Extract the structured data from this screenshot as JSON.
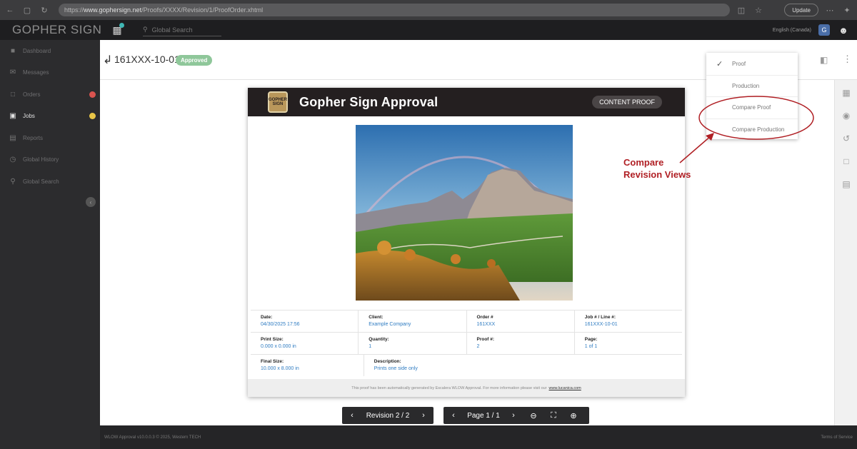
{
  "browser": {
    "url_prefix": "https://",
    "url_host": "www.gophersign.net",
    "url_path": "/Proofs/XXXX/Revision/1/ProofOrder.xhtml",
    "update_label": "Update"
  },
  "app": {
    "logo": "GOPHER SIGN",
    "search_placeholder": "Global Search",
    "language": "English (Canada)",
    "user_initial": "G"
  },
  "sidebar": {
    "items": [
      {
        "label": "Dashboard",
        "icon": "dashboard-icon"
      },
      {
        "label": "Messages",
        "icon": "messages-icon"
      },
      {
        "label": "Orders",
        "icon": "orders-icon",
        "badge_color": "#d9534f"
      },
      {
        "label": "Jobs",
        "icon": "jobs-icon",
        "badge_color": "#e8c547",
        "active": true
      },
      {
        "label": "Reports",
        "icon": "reports-icon"
      },
      {
        "label": "Global History",
        "icon": "history-icon"
      },
      {
        "label": "Global Search",
        "icon": "search-icon"
      }
    ]
  },
  "header": {
    "job_id": "161XXX-10-01",
    "status": "Approved",
    "partial_text": "f"
  },
  "proof": {
    "title": "Gopher Sign Approval",
    "logo_text": "GOPHER SIGN",
    "pill": "CONTENT PROOF",
    "fields": [
      [
        {
          "label": "Date:",
          "value": "04/30/2025 17:56"
        },
        {
          "label": "Client:",
          "value": "Example Company"
        },
        {
          "label": "Order #",
          "value": "161XXX"
        },
        {
          "label": "Job # / Line #:",
          "value": "161XXX-10-01"
        }
      ],
      [
        {
          "label": "Print Size:",
          "value": "0.000 x 0.000 in"
        },
        {
          "label": "Quantity:",
          "value": "1"
        },
        {
          "label": "Proof #:",
          "value": "2"
        },
        {
          "label": "Page:",
          "value": "1 of 1"
        }
      ],
      [
        {
          "label": "Final Size:",
          "value": "10.000 x 8.000 in"
        },
        {
          "label": "Description:",
          "value": "Prints one side only"
        }
      ]
    ],
    "footer_text": "This proof has been automatically generated by Escalera WLOW Approval. For more information please visit our",
    "footer_link": "www.lucanica.com"
  },
  "controls": {
    "revision_label": "Revision 2 / 2",
    "page_label": "Page 1 / 1"
  },
  "status_bar": {
    "left": "WLOW Approval v10.0.0.3 © 2025, Western TECH",
    "right": "Terms of Service"
  },
  "dropdown": {
    "items": [
      {
        "label": "Proof",
        "checked": true
      },
      {
        "label": "Production",
        "checked": false
      },
      {
        "label": "Compare Proof",
        "checked": false
      },
      {
        "label": "Compare Production",
        "checked": false
      }
    ]
  },
  "annotation": {
    "line1": "Compare",
    "line2": "Revision Views",
    "color": "#b01f24"
  }
}
